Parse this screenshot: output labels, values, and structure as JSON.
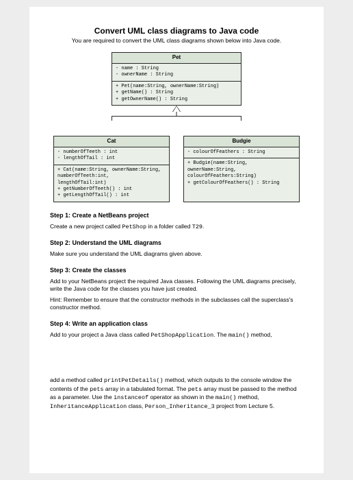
{
  "title": "Convert UML class diagrams to Java code",
  "intro": "You are required to convert the UML class diagrams shown below into Java code.",
  "uml": {
    "pet": {
      "name": "Pet",
      "attrs": [
        "- name : String",
        "- ownerName : String"
      ],
      "methods": [
        "+ Pet(name:String, ownerName:String)",
        "+ getName() : String",
        "+ getOwnerName() : String"
      ]
    },
    "cat": {
      "name": "Cat",
      "attrs": [
        "- numberOfTeeth : int",
        "- lengthOfTail : int"
      ],
      "methods": [
        "+ Cat(name:String, ownerName:String,",
        "      numberOfTeeth:int,",
        "      lengthOfTail:int)",
        "+ getNumberOfTeeth() : int",
        "+ getLengthOfTail() : int"
      ]
    },
    "budgie": {
      "name": "Budgie",
      "attrs": [
        "- colourOfFeathers : String"
      ],
      "methods": [
        "+ Budgie(name:String,",
        "         ownerName:String,",
        "         colourOfFeathers:String)",
        "+ getColourOfFeathers() : String"
      ]
    }
  },
  "steps": {
    "s1": "Step 1: Create a NetBeans project",
    "s1_text_a": "Create a new project called ",
    "s1_code_a": "PetShop",
    "s1_text_b": " in a folder called ",
    "s1_code_b": "T29",
    "s1_text_c": ".",
    "s2": "Step 2: Understand the UML diagrams",
    "s2_text": "Make sure you understand the UML diagrams given above.",
    "s3": "Step 3: Create the classes",
    "s3_text1": "Add to your NetBeans project the required Java classes. Following the UML diagrams precisely, write the Java code for the classes you have just created.",
    "s3_text2": "Hint: Remember to ensure that the constructor methods in the subclasses call the superclass's constructor method.",
    "s4": "Step 4: Write an application class",
    "s4_text_a": "Add to your project a Java class called ",
    "s4_code_a": "PetShopApplication",
    "s4_text_b": ". The ",
    "s4_code_b": "main()",
    "s4_text_c": " method,",
    "tail_a": " add a method called ",
    "tail_code_a": "printPetDetails()",
    "tail_b": " method, which outputs to the console window the contents of the ",
    "tail_code_b": "pets",
    "tail_c": " array in a tabulated format. The ",
    "tail_code_c": "pets",
    "tail_d": " array must be passed to the method as a parameter. Use the ",
    "tail_code_d": "instanceof",
    "tail_e": " operator as shown in the ",
    "tail_code_e": "main()",
    "tail_f": " method, ",
    "tail_code_f": "InheritanceApplication",
    "tail_g": " class, ",
    "tail_code_g": "Person_Inheritance_3",
    "tail_h": " project from Lecture 5."
  }
}
